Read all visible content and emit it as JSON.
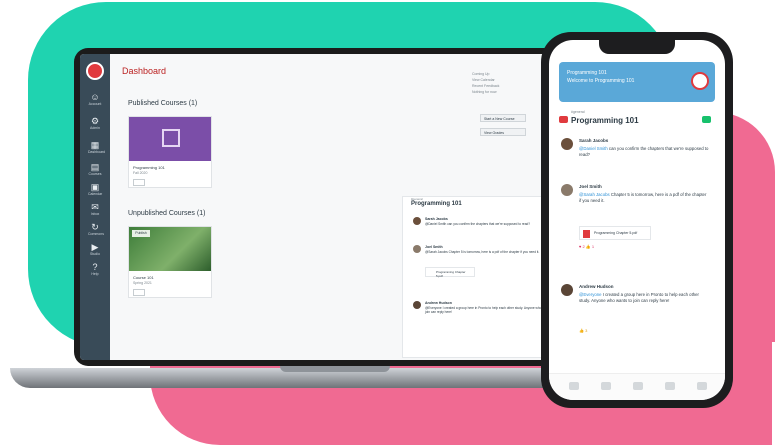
{
  "laptop": {
    "app_title": "Dashboard",
    "published_section": "Published Courses (1)",
    "unpublished_section": "Unpublished Courses (1)",
    "published_card": {
      "name": "Programming 101",
      "sub": "Fall 2020",
      "tag": "Published"
    },
    "unpublished_card": {
      "name": "Course 101",
      "sub": "Spring 2021"
    },
    "sidebar": {
      "items": [
        {
          "label": "Account",
          "icon": "user-icon"
        },
        {
          "label": "Admin",
          "icon": "admin-icon"
        },
        {
          "label": "Dashboard",
          "icon": "dashboard-icon"
        },
        {
          "label": "Courses",
          "icon": "book-icon"
        },
        {
          "label": "Calendar",
          "icon": "calendar-icon"
        },
        {
          "label": "Inbox",
          "icon": "inbox-icon"
        },
        {
          "label": "Commons",
          "icon": "commons-icon"
        },
        {
          "label": "Studio",
          "icon": "studio-icon"
        },
        {
          "label": "Help",
          "icon": "help-icon"
        }
      ]
    },
    "side_panel": {
      "line1": "Coming Up",
      "line2": "View Calendar",
      "line3": "Recent Feedback",
      "line4": "Nothing for now",
      "btn1": "Start a New Course",
      "btn2": "View Grades"
    },
    "chat": {
      "channel_sub": "#general",
      "channel_title": "Programming 101",
      "messages": [
        {
          "who": "Sarah Jacobs",
          "text": "@Daniel Smith can you confirm the chapters that we're supposed to read?"
        },
        {
          "who": "Joel Smith",
          "text": "@Sarah Jacobs Chapter 5 is tomorrow, here is a pdf of the chapter if you need it."
        },
        {
          "who": "Andrew Hudson",
          "text": "@Everyone I created a group here in Pronto to help each other study. Anyone who wants to join can reply here!"
        }
      ],
      "attachment": "Programming Chapter 5.pdf"
    }
  },
  "phone": {
    "banner_line1": "Programming 101",
    "banner_line2": "Welcome to Programming 101",
    "channel_sub": "#general",
    "channel_title": "Programming 101",
    "messages": [
      {
        "who": "Sarah Jacobs",
        "text_pre": "",
        "tag": "@Daniel Smith",
        "text": " can you confirm the chapters that we're supposed to read?"
      },
      {
        "who": "Joel Smith",
        "text_pre": "",
        "tag": "@Sarah Jacobs",
        "text": " Chapter 5 is tomorrow, here is a pdf of the chapter if you need it."
      },
      {
        "who": "Andrew Hudson",
        "text_pre": "",
        "tag": "@Everyone",
        "text": " I created a group here in Pronto to help each other study. Anyone who wants to join can reply here!"
      }
    ],
    "attachment": "Programming Chapter 5.pdf",
    "reaction1": "♥ 2   👍 1",
    "reaction2": "👍 3"
  },
  "colors": {
    "teal": "#1fd3b0",
    "pink": "#f06a92",
    "nav": "#394b58",
    "accent_blue": "#2a8fd6",
    "brand_red": "#e03a3e"
  }
}
